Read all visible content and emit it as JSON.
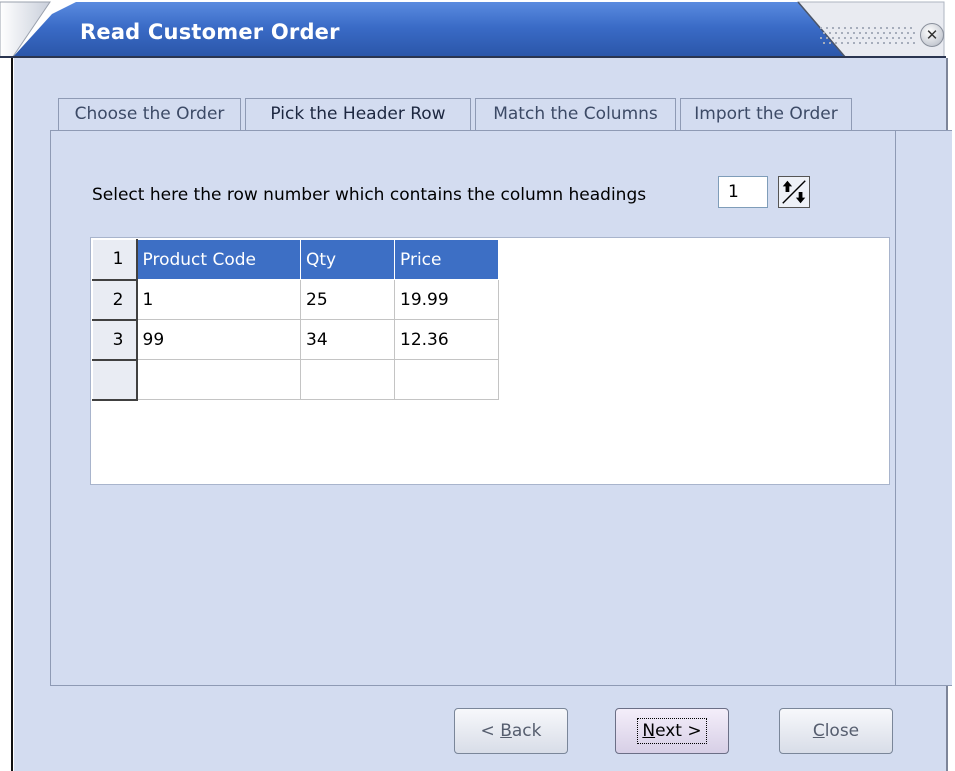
{
  "window": {
    "title": "Read Customer Order"
  },
  "tabs": [
    {
      "label": "Choose the Order"
    },
    {
      "label": "Pick the Header Row"
    },
    {
      "label": "Match the Columns"
    },
    {
      "label": "Import the Order"
    }
  ],
  "header_row": {
    "prompt": "Select here the row number which contains the column headings",
    "value": "1",
    "spin_icon": "spin-up-down-icon"
  },
  "grid": {
    "rows": [
      {
        "num": "1",
        "cells": [
          "Product Code",
          "Qty",
          "Price"
        ]
      },
      {
        "num": "2",
        "cells": [
          "1",
          "25",
          "19.99"
        ]
      },
      {
        "num": "3",
        "cells": [
          "99",
          "34",
          "12.36"
        ]
      },
      {
        "num": "",
        "cells": [
          "",
          "",
          ""
        ]
      }
    ],
    "header_color": "#3d6fc5"
  },
  "buttons": {
    "back": {
      "prefix": "< ",
      "accel": "B",
      "rest": "ack"
    },
    "next": {
      "accel": "N",
      "rest": "ext >"
    },
    "close": {
      "accel": "C",
      "rest": "lose"
    }
  },
  "colors": {
    "titlebar": "#3a6bc6",
    "panel": "#d3dcf0"
  }
}
